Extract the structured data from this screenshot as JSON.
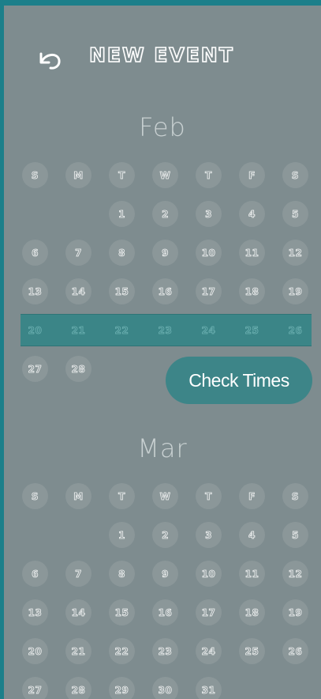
{
  "header": {
    "title": "NEW EVENT",
    "back_icon": "undo-arrow-icon"
  },
  "colors": {
    "frame": "#1c7f8a",
    "panel": "#7e8c8f",
    "accent": "#3d8588"
  },
  "weekdays": [
    "S",
    "M",
    "T",
    "W",
    "T",
    "F",
    "S"
  ],
  "months": [
    {
      "name": "Feb",
      "weeks": [
        [
          "",
          "",
          "1",
          "2",
          "3",
          "4",
          "5"
        ],
        [
          "6",
          "7",
          "8",
          "9",
          "10",
          "11",
          "12"
        ],
        [
          "13",
          "14",
          "15",
          "16",
          "17",
          "18",
          "19"
        ],
        [
          "20",
          "21",
          "22",
          "23",
          "24",
          "25",
          "26"
        ],
        [
          "27",
          "28",
          "",
          "",
          "",
          "",
          ""
        ]
      ],
      "highlighted_week": 3
    },
    {
      "name": "Mar",
      "weeks": [
        [
          "",
          "",
          "1",
          "2",
          "3",
          "4",
          "5"
        ],
        [
          "6",
          "7",
          "8",
          "9",
          "10",
          "11",
          "12"
        ],
        [
          "13",
          "14",
          "15",
          "16",
          "17",
          "18",
          "19"
        ],
        [
          "20",
          "21",
          "22",
          "23",
          "24",
          "25",
          "26"
        ],
        [
          "27",
          "28",
          "29",
          "30",
          "31",
          "",
          ""
        ]
      ],
      "highlighted_week": -1
    }
  ],
  "action": {
    "label": "Check Times"
  }
}
